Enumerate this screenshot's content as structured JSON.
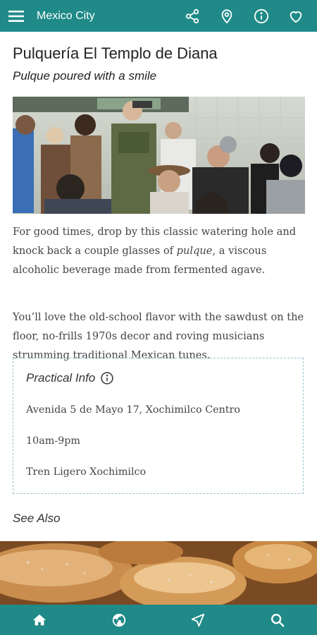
{
  "app_bar": {
    "title": "Mexico City",
    "icons": [
      "menu-icon",
      "share-icon",
      "map-pin-icon",
      "info-icon",
      "heart-icon"
    ]
  },
  "place": {
    "title": "Pulquería El Templo de Diana",
    "subtitle": "Pulque poured with a smile",
    "description": [
      "For good times, drop by this classic watering hole and knock back a couple glasses of pulque, a viscous alcoholic beverage made from fermented agave.",
      "You’ll love the old-school flavor with the sawdust on the floor, no-frills 1970s decor and roving musicians strumming traditional Mexican tunes."
    ]
  },
  "practical_info": {
    "heading": "Practical Info",
    "address": "Avenida 5 de Mayo 17, Xochimilco Centro",
    "hours": "10am-9pm",
    "transit": "Tren Ligero Xochimilco"
  },
  "see_also": {
    "heading": "See Also"
  },
  "bottom_nav": {
    "icons": [
      "home-icon",
      "globe-icon",
      "navigation-arrow-icon",
      "search-icon"
    ]
  },
  "colors": {
    "accent": "#1f8a88",
    "box_border": "#9cc3cf"
  }
}
